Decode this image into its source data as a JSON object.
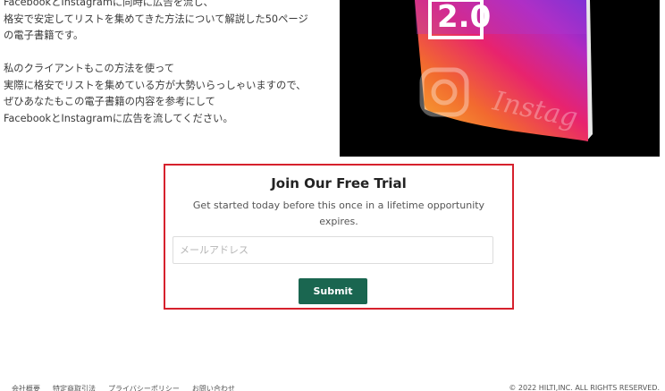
{
  "intro": {
    "lines_a": [
      "FacebookとInstagramに同時に広告を流し、",
      "格安で安定してリストを集めてきた方法について解説した50ページ",
      "の電子書籍です。"
    ],
    "lines_b": [
      "私のクライアントもこの方法を使って",
      "実際に格安でリストを集めている方が大勢いらっしゃいますので、",
      "ぜひあなたもこの電子書籍の内容を参考にして",
      "FacebookとInstagramに広告を流してください。"
    ]
  },
  "hero": {
    "version_text": "2.0",
    "book_script_text": "Instag",
    "icon": "instagram-logo"
  },
  "trial": {
    "title": "Join Our Free Trial",
    "description": "Get started today before this once in a lifetime opportunity expires.",
    "email_placeholder": "メールアドレス",
    "email_value": "",
    "submit_label": "Submit",
    "border_color": "#d6212d",
    "button_color": "#1a6650"
  },
  "footer": {
    "links": [
      "会社概要",
      "特定商取引法",
      "プライバシーポリシー",
      "お問い合わせ"
    ],
    "copyright": "© 2022 HILTI,INC. ALL RIGHTS RESERVED."
  }
}
